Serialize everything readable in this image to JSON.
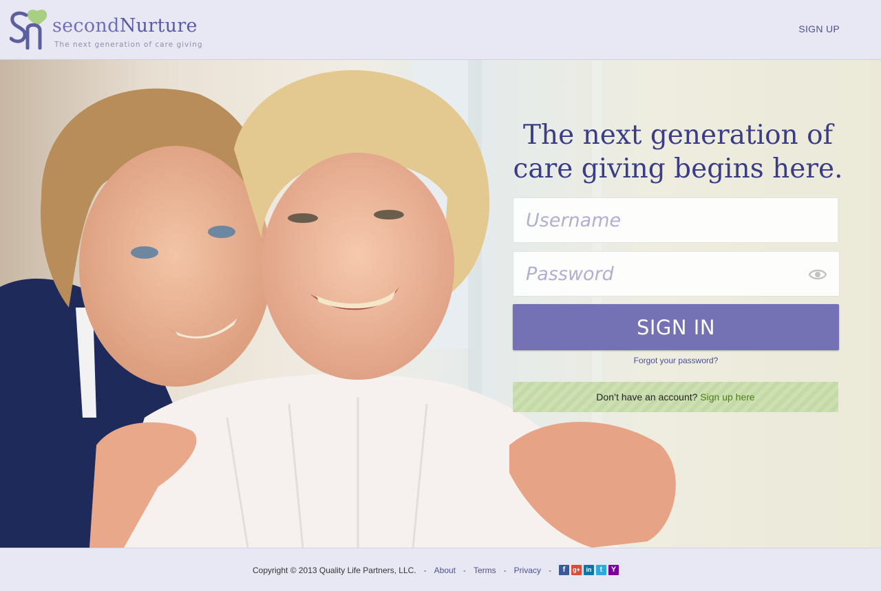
{
  "header": {
    "logo_text_part1": "second",
    "logo_text_part2": "Nurture",
    "tagline": "The next generation of care giving",
    "signup_link": "SIGN UP"
  },
  "hero": {
    "headline_line1": "The next generation of",
    "headline_line2": "care giving begins here.",
    "username_placeholder": "Username",
    "password_placeholder": "Password",
    "signin_label": "SIGN IN",
    "forgot_link": "Forgot your password?",
    "no_account_text": "Don’t have an account?",
    "signup_here_link": "Sign up here"
  },
  "footer": {
    "copyright": "Copyright © 2013 Quality Life Partners, LLC.",
    "links": [
      "About",
      "Terms",
      "Privacy"
    ],
    "separator": "-",
    "social": [
      "facebook-icon",
      "google-plus-icon",
      "linkedin-icon",
      "twitter-icon",
      "yahoo-icon"
    ]
  },
  "colors": {
    "brand_purple": "#7471b4",
    "brand_navy": "#3a3d86",
    "link_blue": "#4b4e9c",
    "signup_green": "#4d7e1d",
    "header_bg": "#e8e8f4"
  }
}
